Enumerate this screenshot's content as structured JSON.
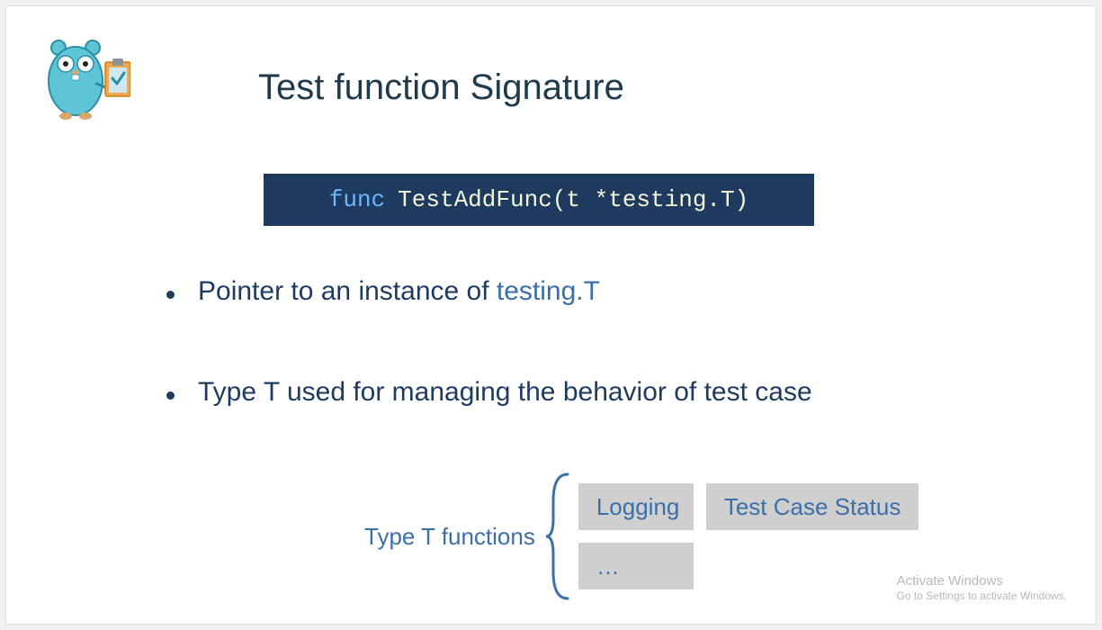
{
  "title": "Test function Signature",
  "icon": "gopher-clipboard",
  "code": {
    "keyword": "func",
    "signature": "TestAddFunc(t *testing.T)"
  },
  "bullets": [
    {
      "prefix": "Pointer to an instance of ",
      "highlight": "testing.T",
      "suffix": ""
    },
    {
      "prefix": "Type T used for managing the behavior of test case",
      "highlight": "",
      "suffix": ""
    }
  ],
  "type_t": {
    "label": "Type T functions",
    "boxes": [
      "Logging",
      "Test Case Status",
      "…"
    ]
  },
  "watermark": {
    "line1": "Activate Windows",
    "line2": "Go to Settings to activate Windows."
  }
}
